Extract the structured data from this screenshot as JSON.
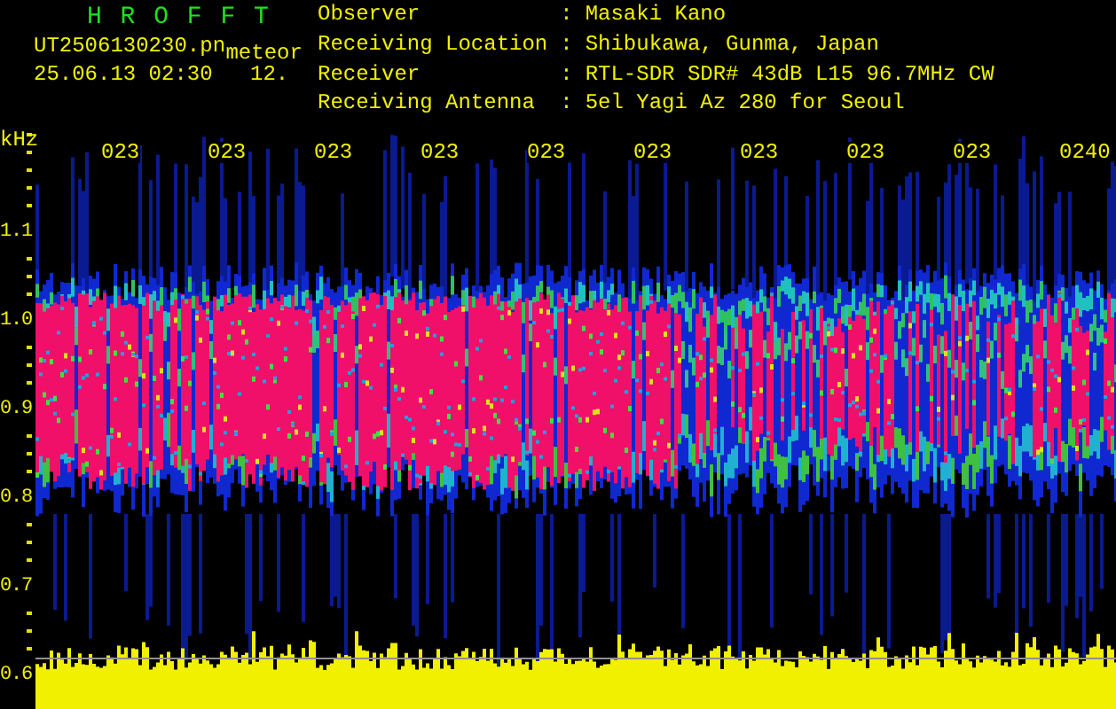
{
  "header": {
    "title": "H R O F F T",
    "file_name": "UT2506130230.pn",
    "file_name_suffix": "meteor",
    "timestamp": "25.06.13 02:30",
    "counter": "12."
  },
  "station_info": [
    {
      "label": "Observer",
      "separator": ":",
      "value": "Masaki Kano"
    },
    {
      "label": "Receiving Location",
      "separator": ":",
      "value": "Shibukawa, Gunma, Japan"
    },
    {
      "label": "Receiver",
      "separator": ":",
      "value": "RTL-SDR SDR# 43dB L15 96.7MHz CW"
    },
    {
      "label": "Receiving Antenna",
      "separator": ":",
      "value": "5el Yagi Az 280 for Seoul"
    }
  ],
  "spectrogram": {
    "unit": "kHz",
    "frequency_labels": [
      "1.1",
      "1.0",
      "0.9",
      "0.8",
      "0.7",
      "0.6"
    ],
    "time_labels": [
      "023",
      "023",
      "023",
      "023",
      "023",
      "023",
      "023",
      "023",
      "023",
      "0240"
    ]
  }
}
